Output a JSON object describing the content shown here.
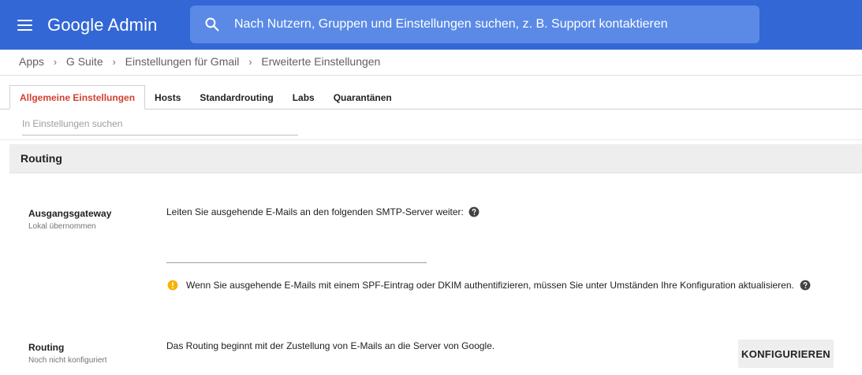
{
  "app": {
    "logo": "Google Admin",
    "search_placeholder": "Nach Nutzern, Gruppen und Einstellungen suchen, z. B. Support kontaktieren",
    "accent_color": "#3367d6"
  },
  "breadcrumb": {
    "items": [
      "Apps",
      "G Suite",
      "Einstellungen für Gmail",
      "Erweiterte Einstellungen"
    ],
    "separator": "›"
  },
  "tabs": [
    {
      "label": "Allgemeine Einstellungen",
      "active": true
    },
    {
      "label": "Hosts",
      "active": false
    },
    {
      "label": "Standardrouting",
      "active": false
    },
    {
      "label": "Labs",
      "active": false
    },
    {
      "label": "Quarantänen",
      "active": false
    }
  ],
  "settings_search": {
    "placeholder": "In Einstellungen suchen",
    "value": ""
  },
  "section": {
    "title": "Routing"
  },
  "outbound_gateway": {
    "title": "Ausgangsgateway",
    "subtitle": "Lokal übernommen",
    "description": "Leiten Sie ausgehende E-Mails an den folgenden SMTP-Server weiter:",
    "smtp_value": "",
    "warning": "Wenn Sie ausgehende E-Mails mit einem SPF-Eintrag oder DKIM authentifizieren, müssen Sie unter Umständen Ihre Konfiguration aktualisieren.",
    "warning_color": "#f4b400"
  },
  "routing": {
    "title": "Routing",
    "subtitle": "Noch nicht konfiguriert",
    "description": "Das Routing beginnt mit der Zustellung von E-Mails an die Server von Google.",
    "button_label": "KONFIGURIEREN"
  }
}
